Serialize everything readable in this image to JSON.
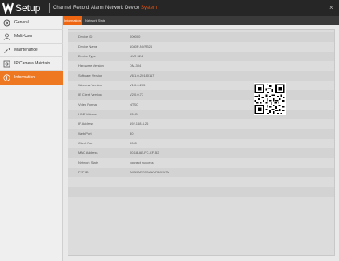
{
  "header": {
    "title": "Setup",
    "menu": [
      "Channel",
      "Record",
      "Alarm",
      "Network",
      "Device",
      "System"
    ],
    "active_menu": "System",
    "close_glyph": "×"
  },
  "tabs": [
    "Information",
    "Network State"
  ],
  "sidebar": {
    "items": [
      {
        "label": "General",
        "icon": "gear-icon"
      },
      {
        "label": "Multi-User",
        "icon": "user-icon"
      },
      {
        "label": "Maintenance",
        "icon": "wrench-icon"
      },
      {
        "label": "IP Camera Maintain",
        "icon": "camera-icon"
      },
      {
        "label": "Information",
        "icon": "info-icon"
      }
    ],
    "active_index": 4
  },
  "info": [
    {
      "label": "Device ID",
      "value": "000000"
    },
    {
      "label": "Device Name",
      "value": "1080P-NVR324"
    },
    {
      "label": "Device Type",
      "value": "NVR 324"
    },
    {
      "label": "Hardware Version",
      "value": "DM-304"
    },
    {
      "label": "Software Version",
      "value": "V6.1.0-20180117"
    },
    {
      "label": "Wireless Version",
      "value": "V1.0.0.205"
    },
    {
      "label": "IE Client Version",
      "value": "V2.0.0.77"
    },
    {
      "label": "Video Format",
      "value": "NTSC"
    },
    {
      "label": "HDD Volume",
      "value": "931G"
    },
    {
      "label": "IP Address",
      "value": "192.168.4.26"
    },
    {
      "label": "Web Port",
      "value": "80"
    },
    {
      "label": "Client Port",
      "value": "9000"
    },
    {
      "label": "MAC Address",
      "value": "00-18-AE-FC-CF-B2"
    },
    {
      "label": "Network State",
      "value": "connect success"
    },
    {
      "label": "P2P ID",
      "value": "AXB9ARTCDAUVRB9117A"
    }
  ],
  "colors": {
    "accent": "#ee7722",
    "topbar": "#262626",
    "subbar": "#3a3a3a"
  }
}
